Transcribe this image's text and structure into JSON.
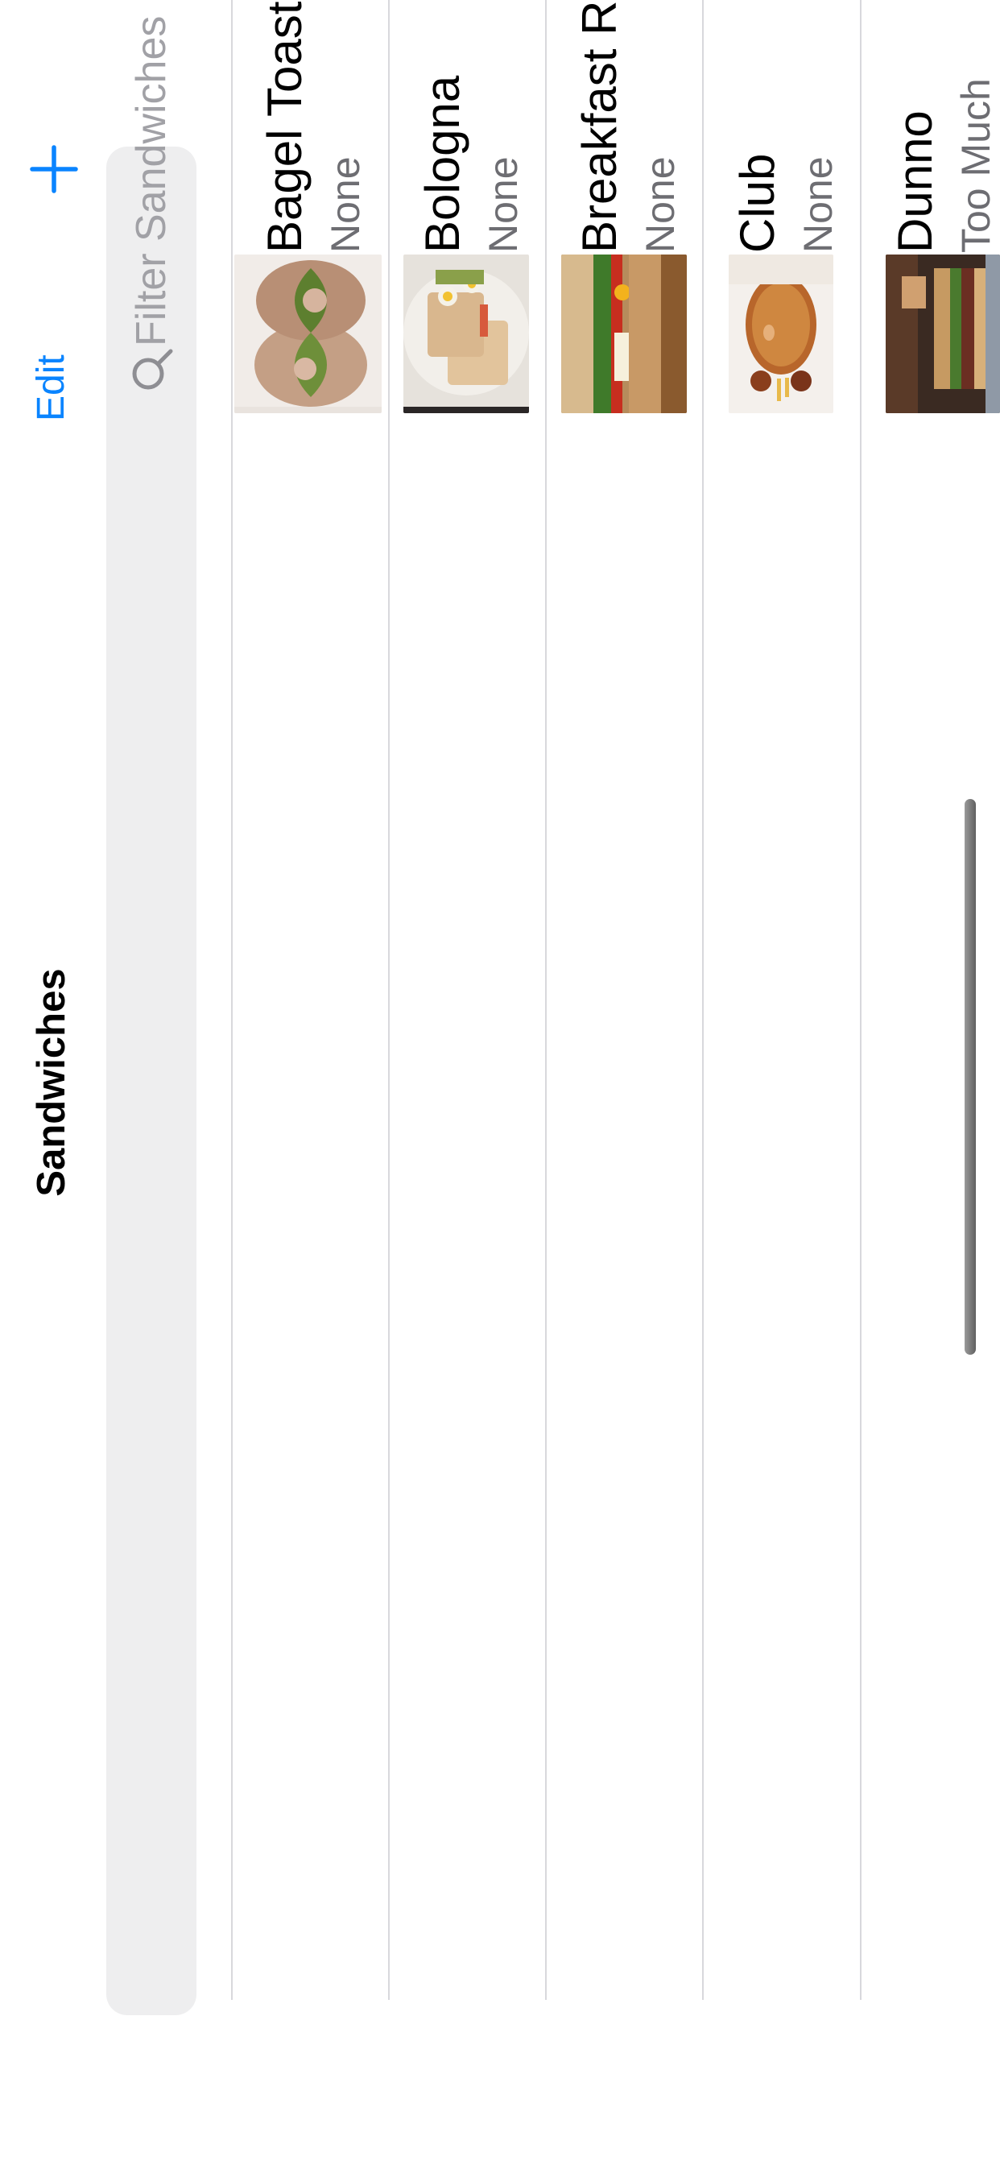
{
  "nav": {
    "edit_label": "Edit",
    "title": "Sandwiches",
    "add_icon": "plus-icon",
    "accent_color": "#0a84ff"
  },
  "search": {
    "placeholder": "Filter Sandwiches",
    "value": "",
    "icon": "magnifying-glass-icon"
  },
  "rows": [
    {
      "title": "Bagel Toast",
      "subtitle": "None"
    },
    {
      "title": "Bologna",
      "subtitle": "None"
    },
    {
      "title": "Breakfast Roll",
      "subtitle": "None"
    },
    {
      "title": "Club",
      "subtitle": "None"
    },
    {
      "title": "Dunno",
      "subtitle": "Too Much"
    }
  ]
}
